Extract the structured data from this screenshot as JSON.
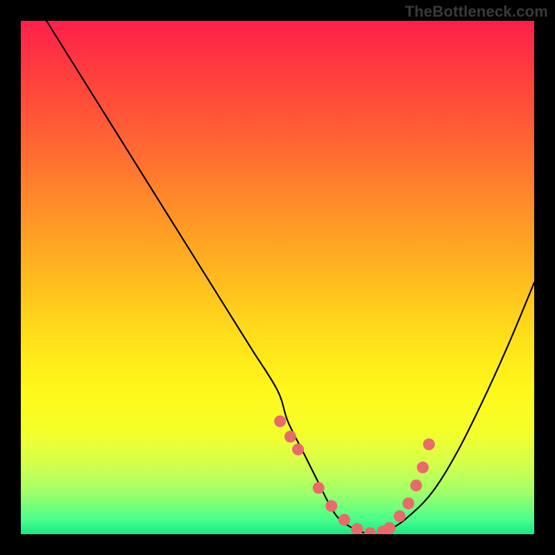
{
  "attribution": "TheBottleneck.com",
  "colors": {
    "page_bg": "#000000",
    "gradient_top": "#ff1f4b",
    "gradient_bottom": "#18e986",
    "curve": "#000000",
    "dot_fill": "#e86a6a"
  },
  "chart_data": {
    "type": "line",
    "title": "",
    "xlabel": "",
    "ylabel": "",
    "xlim": [
      0,
      100
    ],
    "ylim": [
      0,
      100
    ],
    "grid": false,
    "legend": false,
    "series": [
      {
        "name": "bottleneck-curve",
        "x": [
          5,
          10,
          15,
          20,
          25,
          30,
          35,
          40,
          45,
          50,
          52,
          55,
          58,
          60,
          62,
          65,
          68,
          70,
          72,
          75,
          80,
          85,
          90,
          95,
          100
        ],
        "y": [
          100,
          92,
          84,
          76,
          68,
          60,
          52,
          44,
          36,
          28,
          22,
          16,
          10,
          6,
          3,
          1,
          0,
          0,
          1,
          3,
          8,
          16,
          26,
          37,
          49
        ]
      }
    ],
    "markers": {
      "name": "highlight-dots",
      "x": [
        50.5,
        52.5,
        54.0,
        58.0,
        60.5,
        63.0,
        65.5,
        68.0,
        70.5,
        71.8,
        73.8,
        75.5,
        77.0,
        78.3,
        79.5
      ],
      "y": [
        22.0,
        19.0,
        16.5,
        9.0,
        5.5,
        2.8,
        1.0,
        0.2,
        0.5,
        1.2,
        3.5,
        6.0,
        9.5,
        13.0,
        17.5
      ]
    }
  }
}
